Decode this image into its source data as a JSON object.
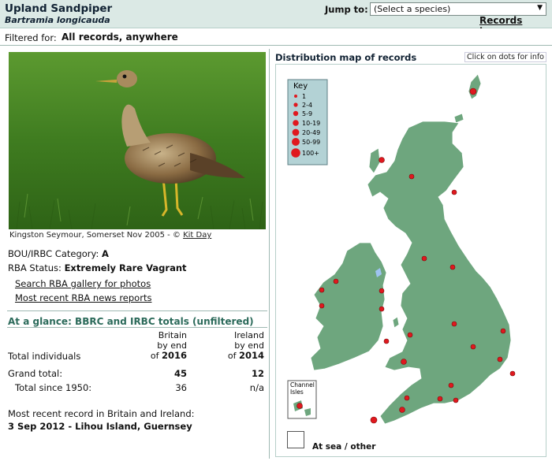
{
  "header": {
    "species_name": "Upland Sandpiper",
    "latin_name": "Bartramia longicauda",
    "jump_label": "Jump to:",
    "select_value": "(Select a species)",
    "records_home": "Records home"
  },
  "filter": {
    "label": "Filtered for:",
    "value": "All records, anywhere"
  },
  "photo": {
    "caption_text": "Kingston Seymour, Somerset Nov 2005 - © ",
    "credit_link": "Kit Day"
  },
  "info": {
    "category_label": "BOU/IRBC Category:",
    "category_value": "A",
    "status_label": "RBA Status:",
    "status_value": "Extremely Rare Vagrant",
    "gallery_link": "Search RBA gallery for photos",
    "news_link": "Most recent RBA news reports"
  },
  "glance": {
    "title": "At a glance: BBRC and IRBC totals (unfiltered)",
    "col_britain": [
      "Britain",
      "by end",
      "of",
      "2016"
    ],
    "col_ireland": [
      "Ireland",
      "by end",
      "of",
      "2014"
    ],
    "total_individuals": "Total individuals",
    "grand_total_label": "Grand total:",
    "grand_total_britain": "45",
    "grand_total_ireland": "12",
    "since_1950_label": "Total since 1950:",
    "since_1950_britain": "36",
    "since_1950_ireland": "n/a"
  },
  "recent": {
    "label": "Most recent record in Britain and Ireland:",
    "value": "3 Sep 2012  - Lihou Island, Guernsey"
  },
  "map": {
    "title": "Distribution map of records",
    "click_info": "Click on dots for info",
    "key_title": "Key",
    "key_items": [
      "1",
      "2-4",
      "5-9",
      "10-19",
      "20-49",
      "50-99",
      "100+"
    ],
    "channel_isles": [
      "Channel",
      "Isles"
    ],
    "at_sea": "At sea / other",
    "colors": {
      "land": "#6ea67e",
      "dot": "#e0181e",
      "key_bg": "#b3d2d5"
    }
  }
}
